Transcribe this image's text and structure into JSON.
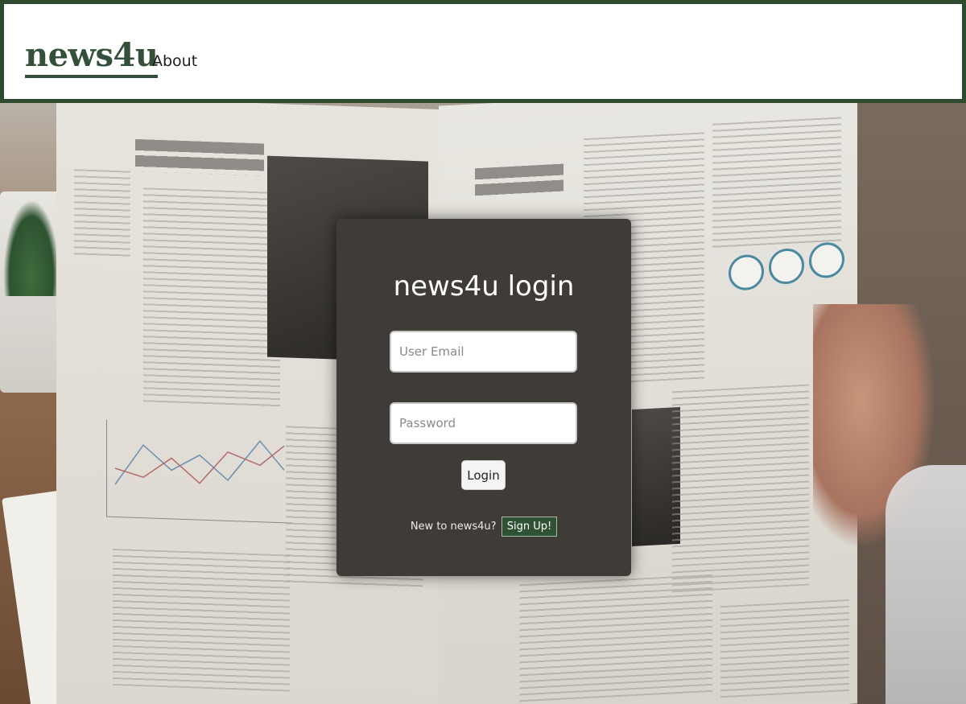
{
  "header": {
    "logo": "news4u",
    "nav": {
      "about": "About"
    }
  },
  "login": {
    "title": "news4u login",
    "email_placeholder": "User Email",
    "password_placeholder": "Password",
    "login_label": "Login",
    "signup_prompt": "New to news4u?",
    "signup_label": "Sign Up!"
  },
  "colors": {
    "brand_green": "#34503a",
    "header_border": "#2f4a2f",
    "card_bg": "#3f3b37",
    "signup_bg": "#2f5234"
  }
}
